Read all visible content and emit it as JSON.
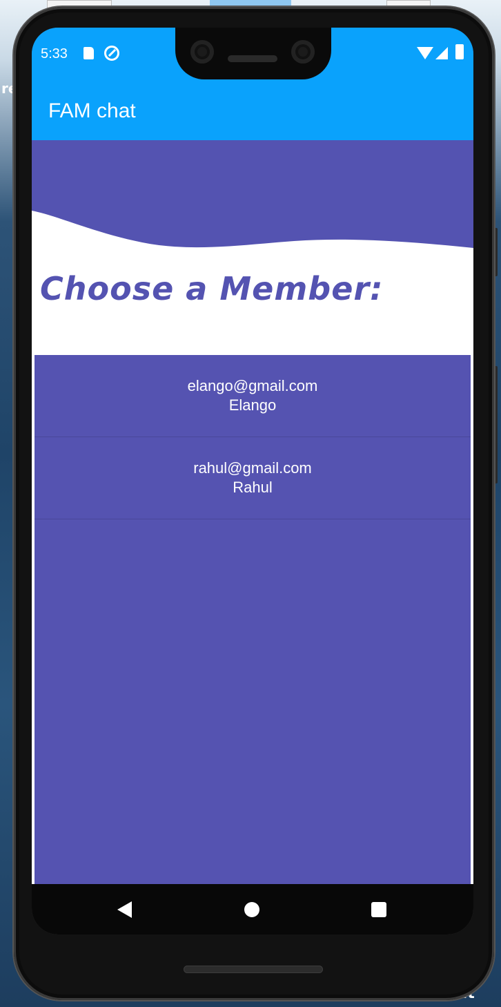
{
  "status_bar": {
    "time": "5:33",
    "icons": [
      "sd-card-icon",
      "data-saver-icon",
      "wifi-icon",
      "signal-icon",
      "battery-icon"
    ]
  },
  "app_bar": {
    "title": "FAM chat",
    "color": "#0aa2fc"
  },
  "main": {
    "heading": "Choose a Member:",
    "accent_color": "#5453b1",
    "members": [
      {
        "email": "elango@gmail.com",
        "name": "Elango"
      },
      {
        "email": "rahul@gmail.com",
        "name": "Rahul"
      }
    ]
  },
  "nav_bar": {
    "buttons": [
      "back-icon",
      "home-icon",
      "recent-apps-icon"
    ]
  },
  "desktop": {
    "left_text": "re",
    "bottom_text": "ult"
  }
}
